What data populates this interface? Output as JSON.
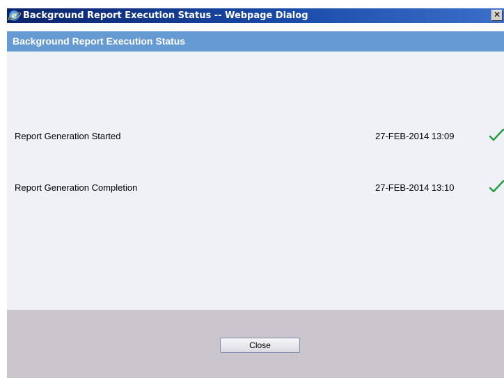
{
  "window": {
    "title": "Background Report Execution Status -- Webpage Dialog",
    "close_glyph": "✕"
  },
  "panel": {
    "header": "Background Report Execution Status"
  },
  "statuses": [
    {
      "label": "Report Generation Started",
      "timestamp": "27-FEB-2014 13:09",
      "icon": "check-icon",
      "icon_color": "#1e9e3c"
    },
    {
      "label": "Report Generation Completion",
      "timestamp": "27-FEB-2014 13:10",
      "icon": "check-icon",
      "icon_color": "#1e9e3c"
    }
  ],
  "footer": {
    "close_label": "Close"
  },
  "colors": {
    "title_bar": "#0a246a",
    "panel_header": "#659ad2",
    "content_background": "#f0f0f7",
    "footer_background": "#cbc6cd"
  }
}
